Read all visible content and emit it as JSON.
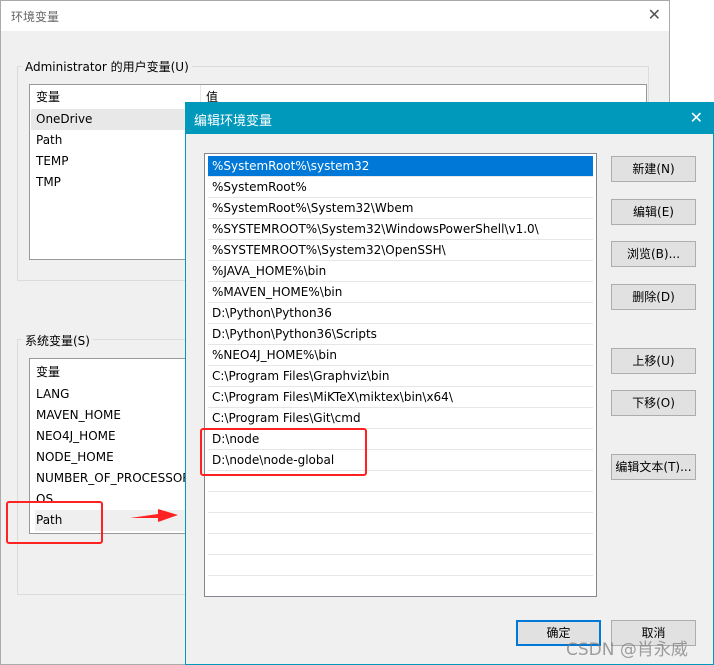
{
  "back_window": {
    "title": "环境变量",
    "user_group": "Administrator 的用户变量(U)",
    "user_headers": [
      "变量",
      "值"
    ],
    "user_vars": [
      "OneDrive",
      "Path",
      "TEMP",
      "TMP"
    ],
    "system_group": "系统变量(S)",
    "system_header": "变量",
    "system_vars": [
      "LANG",
      "MAVEN_HOME",
      "NEO4J_HOME",
      "NODE_HOME",
      "NUMBER_OF_PROCESSORS",
      "OS",
      "Path"
    ]
  },
  "dialog": {
    "title": "编辑环境变量",
    "paths": [
      "%SystemRoot%\\system32",
      "%SystemRoot%",
      "%SystemRoot%\\System32\\Wbem",
      "%SYSTEMROOT%\\System32\\WindowsPowerShell\\v1.0\\",
      "%SYSTEMROOT%\\System32\\OpenSSH\\",
      "%JAVA_HOME%\\bin",
      "%MAVEN_HOME%\\bin",
      "D:\\Python\\Python36",
      "D:\\Python\\Python36\\Scripts",
      "%NEO4J_HOME%\\bin",
      "C:\\Program Files\\Graphviz\\bin",
      "C:\\Program Files\\MiKTeX\\miktex\\bin\\x64\\",
      "C:\\Program Files\\Git\\cmd",
      "D:\\node",
      "D:\\node\\node-global"
    ],
    "buttons": {
      "new": "新建(N)",
      "edit": "编辑(E)",
      "browse": "浏览(B)...",
      "delete": "删除(D)",
      "up": "上移(U)",
      "down": "下移(O)",
      "edit_text": "编辑文本(T)...",
      "ok": "确定",
      "cancel": "取消"
    }
  },
  "watermark": "CSDN @肖永威",
  "colors": {
    "accent": "#0099bc",
    "selection": "#0078d7",
    "highlight": "#ff2222"
  }
}
